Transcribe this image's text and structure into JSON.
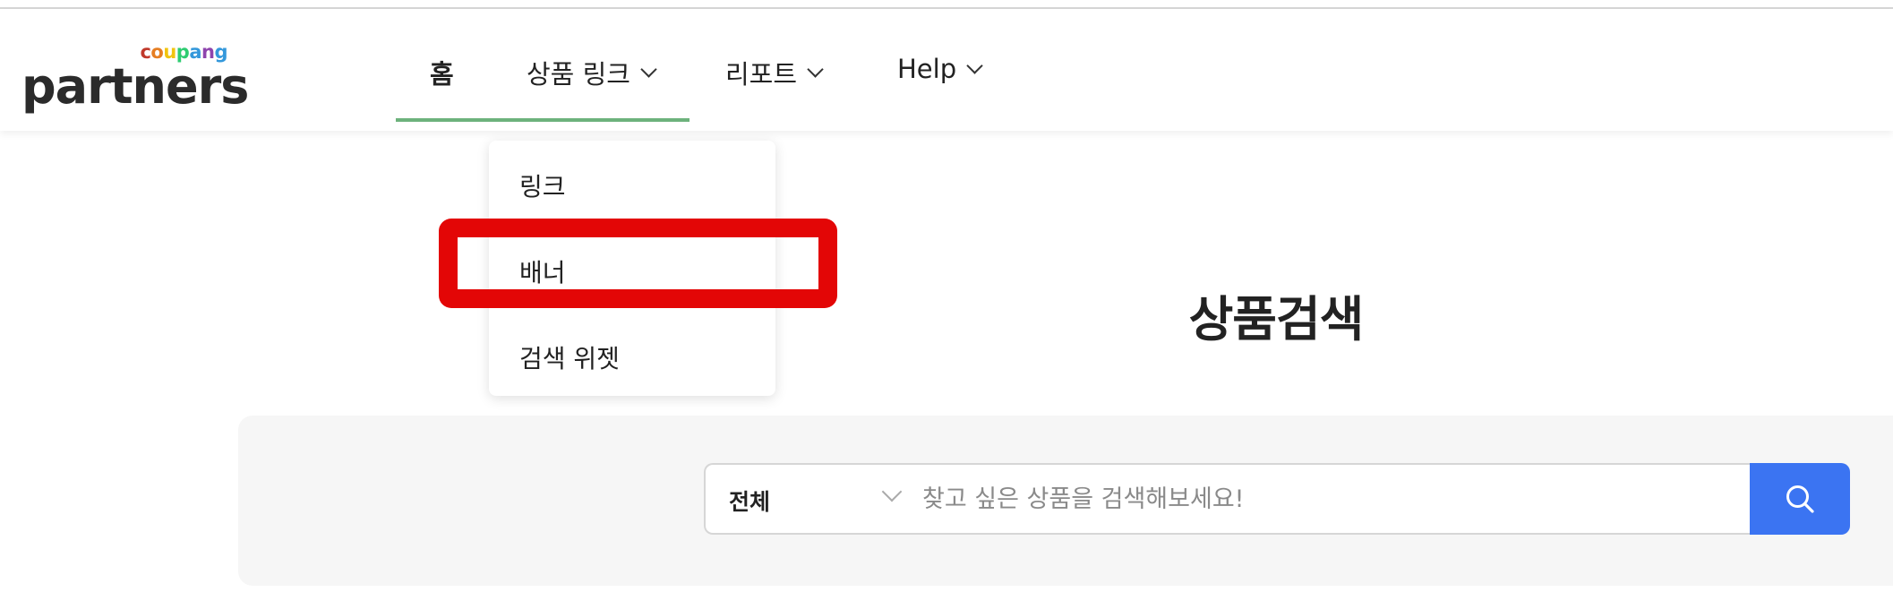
{
  "logo": {
    "brand_small": "coupang",
    "brand_large": "partners",
    "brand_colors": [
      "#c0392b",
      "#e67e22",
      "#f1c40f",
      "#2ecc71",
      "#3498db",
      "#8e44ad",
      "#3498db"
    ]
  },
  "nav": {
    "items": [
      {
        "label": "홈",
        "has_dropdown": false
      },
      {
        "label": "상품 링크",
        "has_dropdown": true
      },
      {
        "label": "리포트",
        "has_dropdown": true
      },
      {
        "label": "Help",
        "has_dropdown": true
      }
    ],
    "active_color": "#6db27c"
  },
  "dropdown": {
    "items": [
      {
        "label": "링크"
      },
      {
        "label": "배너"
      },
      {
        "label": "검색 위젯"
      }
    ],
    "highlighted": "배너",
    "highlight_color": "#e30606"
  },
  "main": {
    "title": "상품검색"
  },
  "search": {
    "category": "전체",
    "placeholder": "찾고 싶은 상품을 검색해보세요!",
    "button_icon": "search-icon",
    "button_color": "#3b74f2"
  }
}
